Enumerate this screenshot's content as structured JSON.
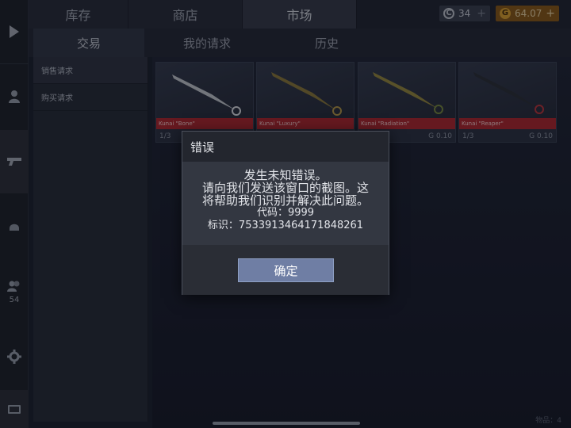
{
  "top_tabs": [
    "库存",
    "商店",
    "市场"
  ],
  "currency": {
    "silver": "34",
    "gold": "64.07",
    "plus": "+"
  },
  "sub_tabs": [
    "交易",
    "我的请求",
    "历史"
  ],
  "requests_panel": {
    "items": [
      "销售请求",
      "购买请求"
    ]
  },
  "rail": {
    "friends_count": "54"
  },
  "market_cards": [
    {
      "name": "Kunai \"Bone\"",
      "count": "1/3",
      "price": ""
    },
    {
      "name": "Kunai \"Luxury\"",
      "count": "",
      "price": ""
    },
    {
      "name": "Kunai \"Radiation\"",
      "count": "",
      "price": "0.10"
    },
    {
      "name": "Kunai \"Reaper\"",
      "count": "1/3",
      "price": "0.10"
    }
  ],
  "footer": {
    "page_hint": "物品：4"
  },
  "dialog": {
    "title": "错误",
    "lines": [
      "发生未知错误。",
      "请向我们发送该窗口的截图。这",
      "将帮助我们识别并解决此问题。",
      "代码：9999",
      "标识：7533913464171848261"
    ],
    "ok_label": "确定"
  },
  "colors": {
    "accent_gold": "#8c5a14",
    "card_label_red": "#b3262c",
    "ok_button": "#6f7ea4"
  },
  "icons": [
    "play-icon",
    "profile-icon",
    "gun-icon",
    "helmet-icon",
    "friends-icon",
    "gear-icon",
    "mail-icon",
    "silver-coin-icon",
    "gold-coin-icon"
  ]
}
